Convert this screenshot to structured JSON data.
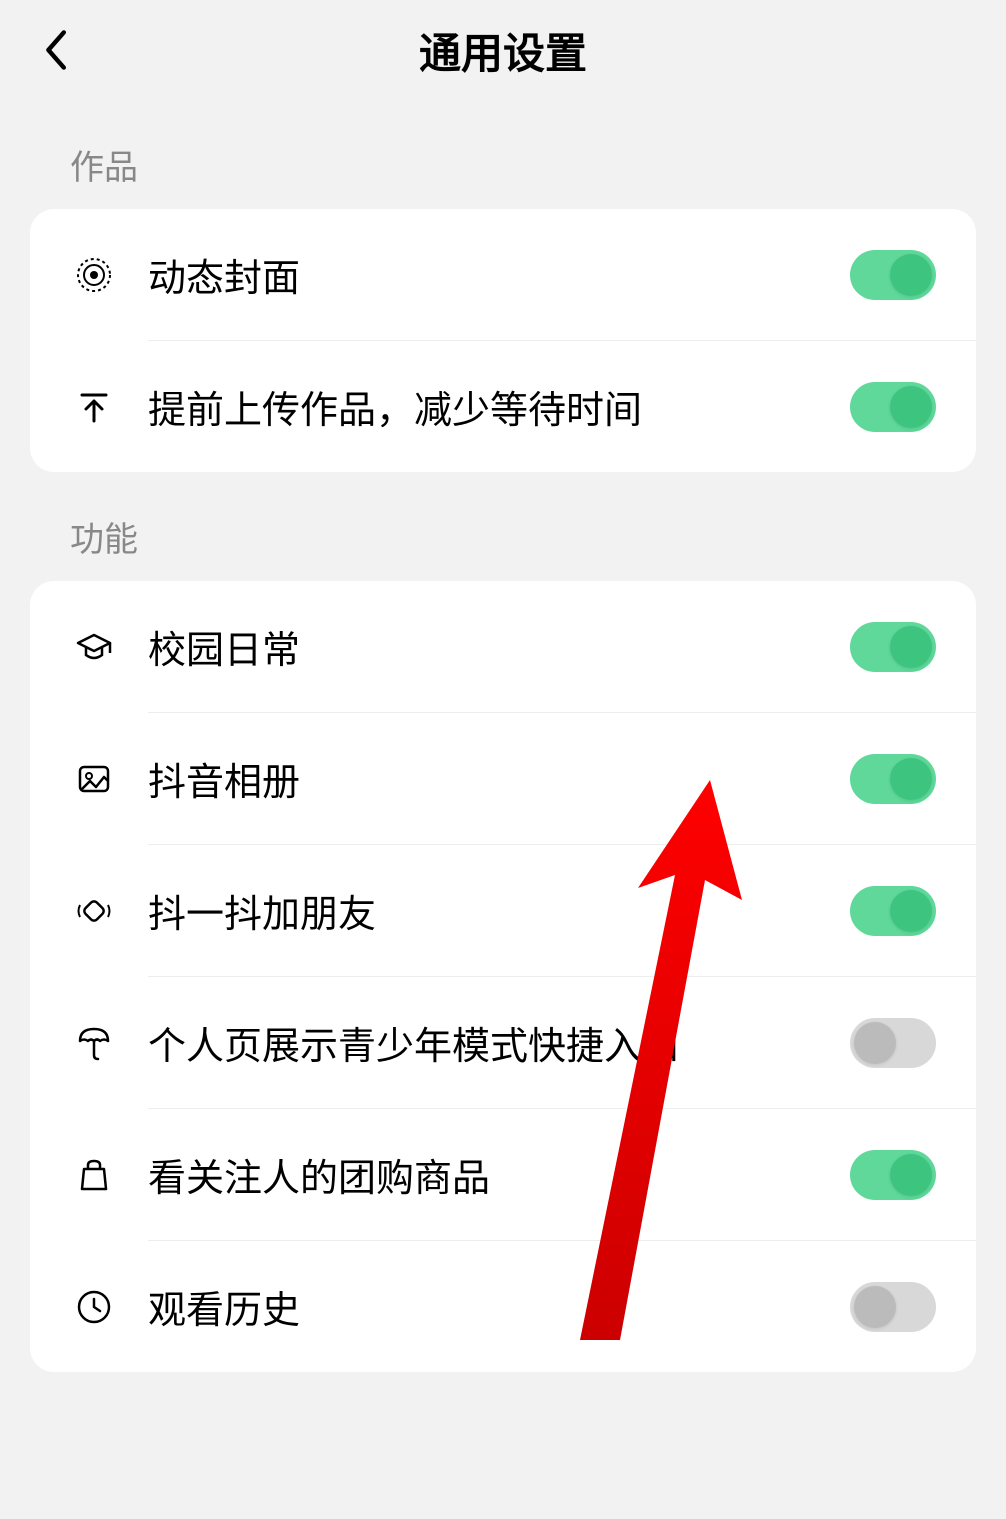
{
  "header": {
    "title": "通用设置"
  },
  "sections": [
    {
      "label": "作品",
      "items": [
        {
          "icon": "target",
          "label": "动态封面",
          "enabled": true
        },
        {
          "icon": "upload",
          "label": "提前上传作品，减少等待时间",
          "enabled": true
        }
      ]
    },
    {
      "label": "功能",
      "items": [
        {
          "icon": "graduation",
          "label": "校园日常",
          "enabled": true
        },
        {
          "icon": "image",
          "label": "抖音相册",
          "enabled": true
        },
        {
          "icon": "shake",
          "label": "抖一抖加朋友",
          "enabled": true
        },
        {
          "icon": "umbrella",
          "label": "个人页展示青少年模式快捷入口",
          "enabled": false
        },
        {
          "icon": "bag",
          "label": "看关注人的团购商品",
          "enabled": true
        },
        {
          "icon": "clock",
          "label": "观看历史",
          "enabled": false
        }
      ]
    }
  ],
  "annotation": {
    "type": "arrow",
    "color": "#e60000"
  }
}
